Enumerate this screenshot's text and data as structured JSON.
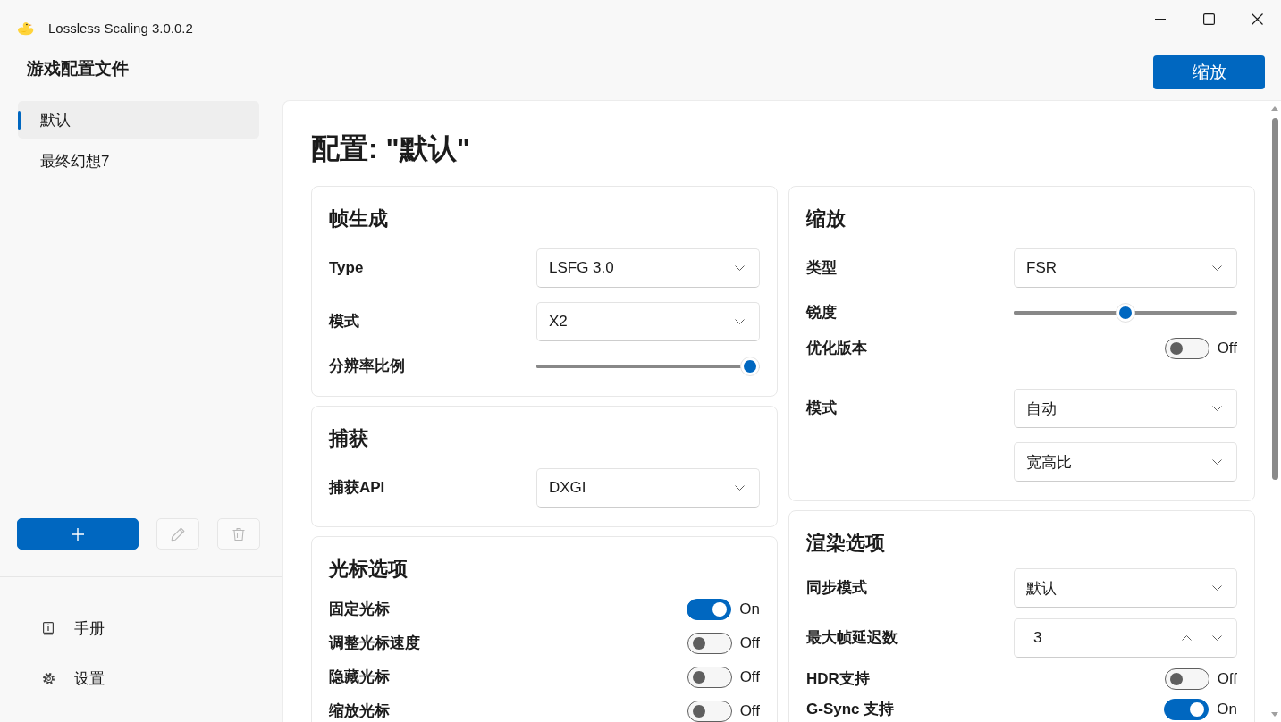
{
  "window": {
    "title": "Lossless Scaling 3.0.0.2"
  },
  "sidebar": {
    "heading": "游戏配置文件",
    "profiles": [
      {
        "label": "默认",
        "selected": true
      },
      {
        "label": "最终幻想7",
        "selected": false
      }
    ],
    "actions": [
      {
        "kind": "add",
        "disabled": false
      },
      {
        "kind": "edit",
        "disabled": true
      },
      {
        "kind": "delete",
        "disabled": true
      }
    ],
    "nav": [
      {
        "kind": "manual",
        "label": "手册"
      },
      {
        "kind": "settings",
        "label": "设置"
      }
    ]
  },
  "header": {
    "scale_button": "缩放"
  },
  "main": {
    "title": "配置: \"默认\"",
    "columns": [
      {
        "cards": [
          {
            "title": "帧生成",
            "rows": [
              {
                "kind": "dropdown",
                "label": "Type",
                "values": [
                  "LSFG 3.0"
                ]
              },
              {
                "kind": "dropdown",
                "label": "模式",
                "values": [
                  "X2"
                ]
              },
              {
                "kind": "slider",
                "label": "分辨率比例",
                "level": 1
              }
            ]
          },
          {
            "title": "捕获",
            "rows": [
              {
                "kind": "dropdown",
                "label": "捕获API",
                "values": [
                  "DXGI"
                ]
              }
            ]
          },
          {
            "title": "光标选项",
            "rows": [
              {
                "kind": "toggle",
                "label": "固定光标",
                "on": true,
                "state_text": "On"
              },
              {
                "kind": "toggle",
                "label": "调整光标速度",
                "on": false,
                "state_text": "Off"
              },
              {
                "kind": "toggle",
                "label": "隐藏光标",
                "on": false,
                "state_text": "Off"
              },
              {
                "kind": "toggle",
                "label": "缩放光标",
                "on": false,
                "state_text": "Off"
              }
            ]
          }
        ]
      },
      {
        "cards": [
          {
            "title": "缩放",
            "rows": [
              {
                "kind": "dropdown",
                "label": "类型",
                "values": [
                  "FSR"
                ]
              },
              {
                "kind": "slider",
                "label": "锐度",
                "level": 0.5
              },
              {
                "kind": "toggle",
                "label": "优化版本",
                "on": false,
                "state_text": "Off"
              },
              {
                "kind": "divider"
              },
              {
                "kind": "dropdown",
                "label": "模式",
                "values": [
                  "自动",
                  "宽高比"
                ]
              }
            ]
          },
          {
            "title": "渲染选项",
            "rows": [
              {
                "kind": "dropdown",
                "label": "同步模式",
                "values": [
                  "默认"
                ]
              },
              {
                "kind": "number",
                "label": "最大帧延迟数",
                "value": "3"
              },
              {
                "kind": "toggle",
                "label": "HDR支持",
                "on": false,
                "state_text": "Off"
              },
              {
                "kind": "toggle",
                "label": "G-Sync 支持",
                "on": true,
                "state_text": "On"
              }
            ]
          }
        ]
      }
    ]
  }
}
